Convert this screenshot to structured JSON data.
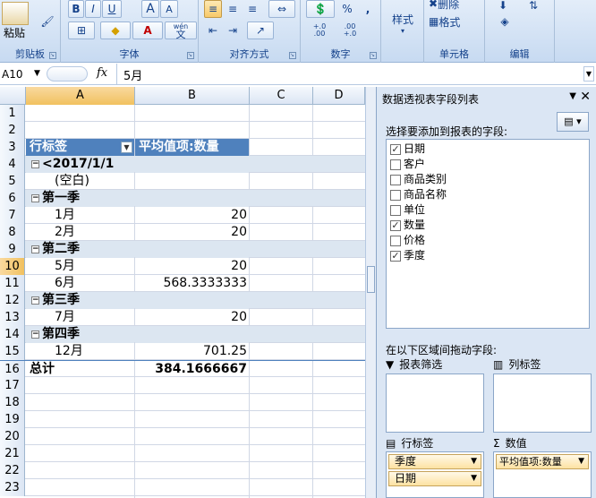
{
  "ribbon": {
    "clipboard": {
      "paste_label": "粘贴",
      "group_label": "剪贴板"
    },
    "font": {
      "group_label": "字体",
      "bold": "B",
      "italic": "I",
      "underline": "U",
      "grow": "A",
      "shrink": "A",
      "wen": "wén",
      "wen2": "文",
      "fontcolor": "A"
    },
    "alignment": {
      "group_label": "对齐方式"
    },
    "number": {
      "group_label": "数字",
      "percent": "%",
      "comma": ",",
      "inc": "+.0 .00",
      "dec": ".00 +.0"
    },
    "styles": {
      "label": "样式"
    },
    "cells": {
      "group_label": "单元格",
      "delete_label": "删除",
      "format_label": "格式"
    },
    "editing": {
      "group_label": "编辑"
    }
  },
  "formula_bar": {
    "name_box": "A10",
    "fx": "fx",
    "value": "5月"
  },
  "columns": [
    "A",
    "B",
    "C",
    "D"
  ],
  "rows": [
    {
      "num": "1",
      "a": "",
      "b": ""
    },
    {
      "num": "2",
      "a": "",
      "b": ""
    },
    {
      "num": "3",
      "a": "行标签",
      "b": "平均值项:数量"
    },
    {
      "num": "4",
      "a": "<2017/1/1",
      "b": ""
    },
    {
      "num": "5",
      "a": "(空白)",
      "b": ""
    },
    {
      "num": "6",
      "a": "第一季",
      "b": ""
    },
    {
      "num": "7",
      "a": "1月",
      "b": "20"
    },
    {
      "num": "8",
      "a": "2月",
      "b": "20"
    },
    {
      "num": "9",
      "a": "第二季",
      "b": ""
    },
    {
      "num": "10",
      "a": "5月",
      "b": "20"
    },
    {
      "num": "11",
      "a": "6月",
      "b": "568.3333333"
    },
    {
      "num": "12",
      "a": "第三季",
      "b": ""
    },
    {
      "num": "13",
      "a": "7月",
      "b": "20"
    },
    {
      "num": "14",
      "a": "第四季",
      "b": ""
    },
    {
      "num": "15",
      "a": "12月",
      "b": "701.25"
    },
    {
      "num": "16",
      "a": "总计",
      "b": "384.1666667"
    },
    {
      "num": "17",
      "a": "",
      "b": ""
    },
    {
      "num": "18",
      "a": "",
      "b": ""
    },
    {
      "num": "19",
      "a": "",
      "b": ""
    },
    {
      "num": "20",
      "a": "",
      "b": ""
    },
    {
      "num": "21",
      "a": "",
      "b": ""
    },
    {
      "num": "22",
      "a": "",
      "b": ""
    },
    {
      "num": "23",
      "a": "",
      "b": ""
    }
  ],
  "pivot_pane": {
    "title": "数据透视表字段列表",
    "choose_label": "选择要添加到报表的字段:",
    "fields": [
      {
        "name": "日期",
        "checked": true
      },
      {
        "name": "客户",
        "checked": false
      },
      {
        "name": "商品类别",
        "checked": false
      },
      {
        "name": "商品名称",
        "checked": false
      },
      {
        "name": "单位",
        "checked": false
      },
      {
        "name": "数量",
        "checked": true
      },
      {
        "name": "价格",
        "checked": false
      },
      {
        "name": "季度",
        "checked": true
      }
    ],
    "drag_label": "在以下区域间拖动字段:",
    "report_filter": "报表筛选",
    "col_labels": "列标签",
    "row_labels": "行标签",
    "values": "数值",
    "row_items": [
      "季度",
      "日期"
    ],
    "value_items": [
      "平均值项:数量"
    ]
  }
}
